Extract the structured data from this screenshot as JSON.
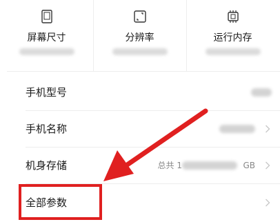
{
  "specs": [
    {
      "label": "屏幕尺寸",
      "icon": "screen-size-icon"
    },
    {
      "label": "分辨率",
      "icon": "resolution-icon"
    },
    {
      "label": "运行内存",
      "icon": "memory-chip-icon"
    }
  ],
  "rows": {
    "model": {
      "label": "手机型号"
    },
    "name": {
      "label": "手机名称"
    },
    "storage": {
      "label": "机身存储",
      "value_prefix": "总共 1",
      "value_suffix": "GB"
    },
    "all_params": {
      "label": "全部参数"
    }
  },
  "colors": {
    "annotation_red": "#e02020",
    "divider": "#ededed",
    "chevron": "#c8c8c8"
  }
}
